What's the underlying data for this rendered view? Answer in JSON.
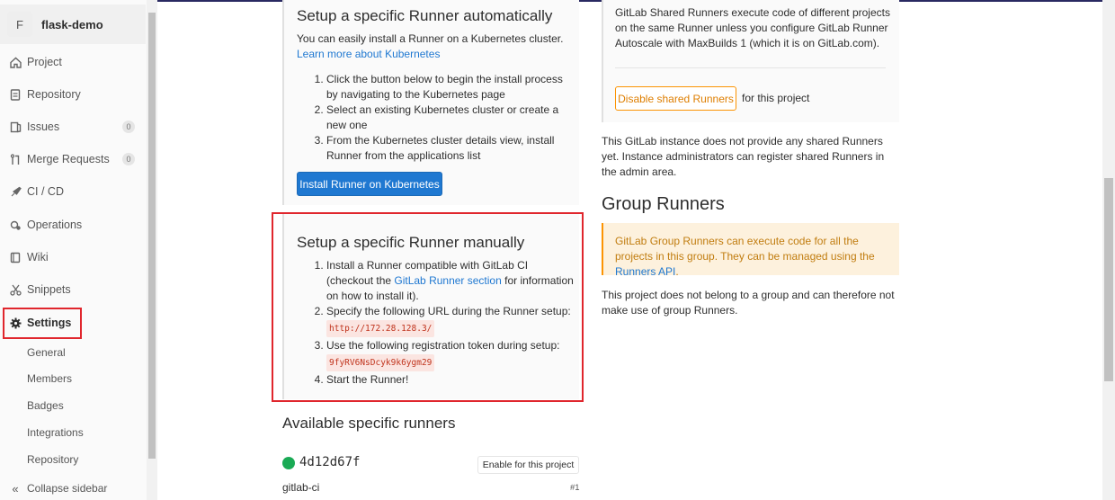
{
  "sidebar": {
    "project_initial": "F",
    "project_name": "flask-demo",
    "items": [
      {
        "label": "Project"
      },
      {
        "label": "Repository"
      },
      {
        "label": "Issues",
        "badge": "0"
      },
      {
        "label": "Merge Requests",
        "badge": "0"
      },
      {
        "label": "CI / CD"
      },
      {
        "label": "Operations"
      },
      {
        "label": "Wiki"
      },
      {
        "label": "Snippets"
      },
      {
        "label": "Settings"
      }
    ],
    "sub_items": [
      "General",
      "Members",
      "Badges",
      "Integrations",
      "Repository"
    ],
    "collapse_label": "Collapse sidebar"
  },
  "auto": {
    "title": "Setup a specific Runner automatically",
    "intro": "You can easily install a Runner on a Kubernetes cluster.",
    "link": "Learn more about Kubernetes",
    "steps": [
      "Click the button below to begin the install process by navigating to the Kubernetes page",
      "Select an existing Kubernetes cluster or create a new one",
      "From the Kubernetes cluster details view, install Runner from the applications list"
    ],
    "button": "Install Runner on Kubernetes"
  },
  "manual": {
    "title": "Setup a specific Runner manually",
    "step1_pre": "Install a Runner compatible with GitLab CI (checkout the ",
    "step1_link": "GitLab Runner section",
    "step1_post": " for information on how to install it).",
    "step2": "Specify the following URL during the Runner setup:",
    "url": "http://172.28.128.3/",
    "step3": "Use the following registration token during setup:",
    "token": "9fyRV6NsDcyk9k6ygm29",
    "step4": "Start the Runner!"
  },
  "available": {
    "title": "Available specific runners",
    "runner_id": "4d12d67f",
    "enable_button": "Enable for this project",
    "description": "gitlab-ci",
    "number": "#1"
  },
  "shared": {
    "text": "GitLab Shared Runners execute code of different projects on the same Runner unless you configure GitLab Runner Autoscale with MaxBuilds 1 (which it is on GitLab.com).",
    "disable_button": "Disable shared Runners",
    "for_project": "for this project",
    "none_text": "This GitLab instance does not provide any shared Runners yet. Instance administrators can register shared Runners in the admin area."
  },
  "group": {
    "title": "Group Runners",
    "warn_text": "GitLab Group Runners can execute code for all the projects in this group. They can be managed using the ",
    "warn_link": "Runners API",
    "warn_end": ".",
    "no_group": "This project does not belong to a group and can therefore not make use of group Runners."
  },
  "colors": {
    "accent_blue": "#1f78d1",
    "highlight_red": "#e0262d",
    "warning_orange": "#fc9403",
    "online_green": "#1aaa55"
  }
}
